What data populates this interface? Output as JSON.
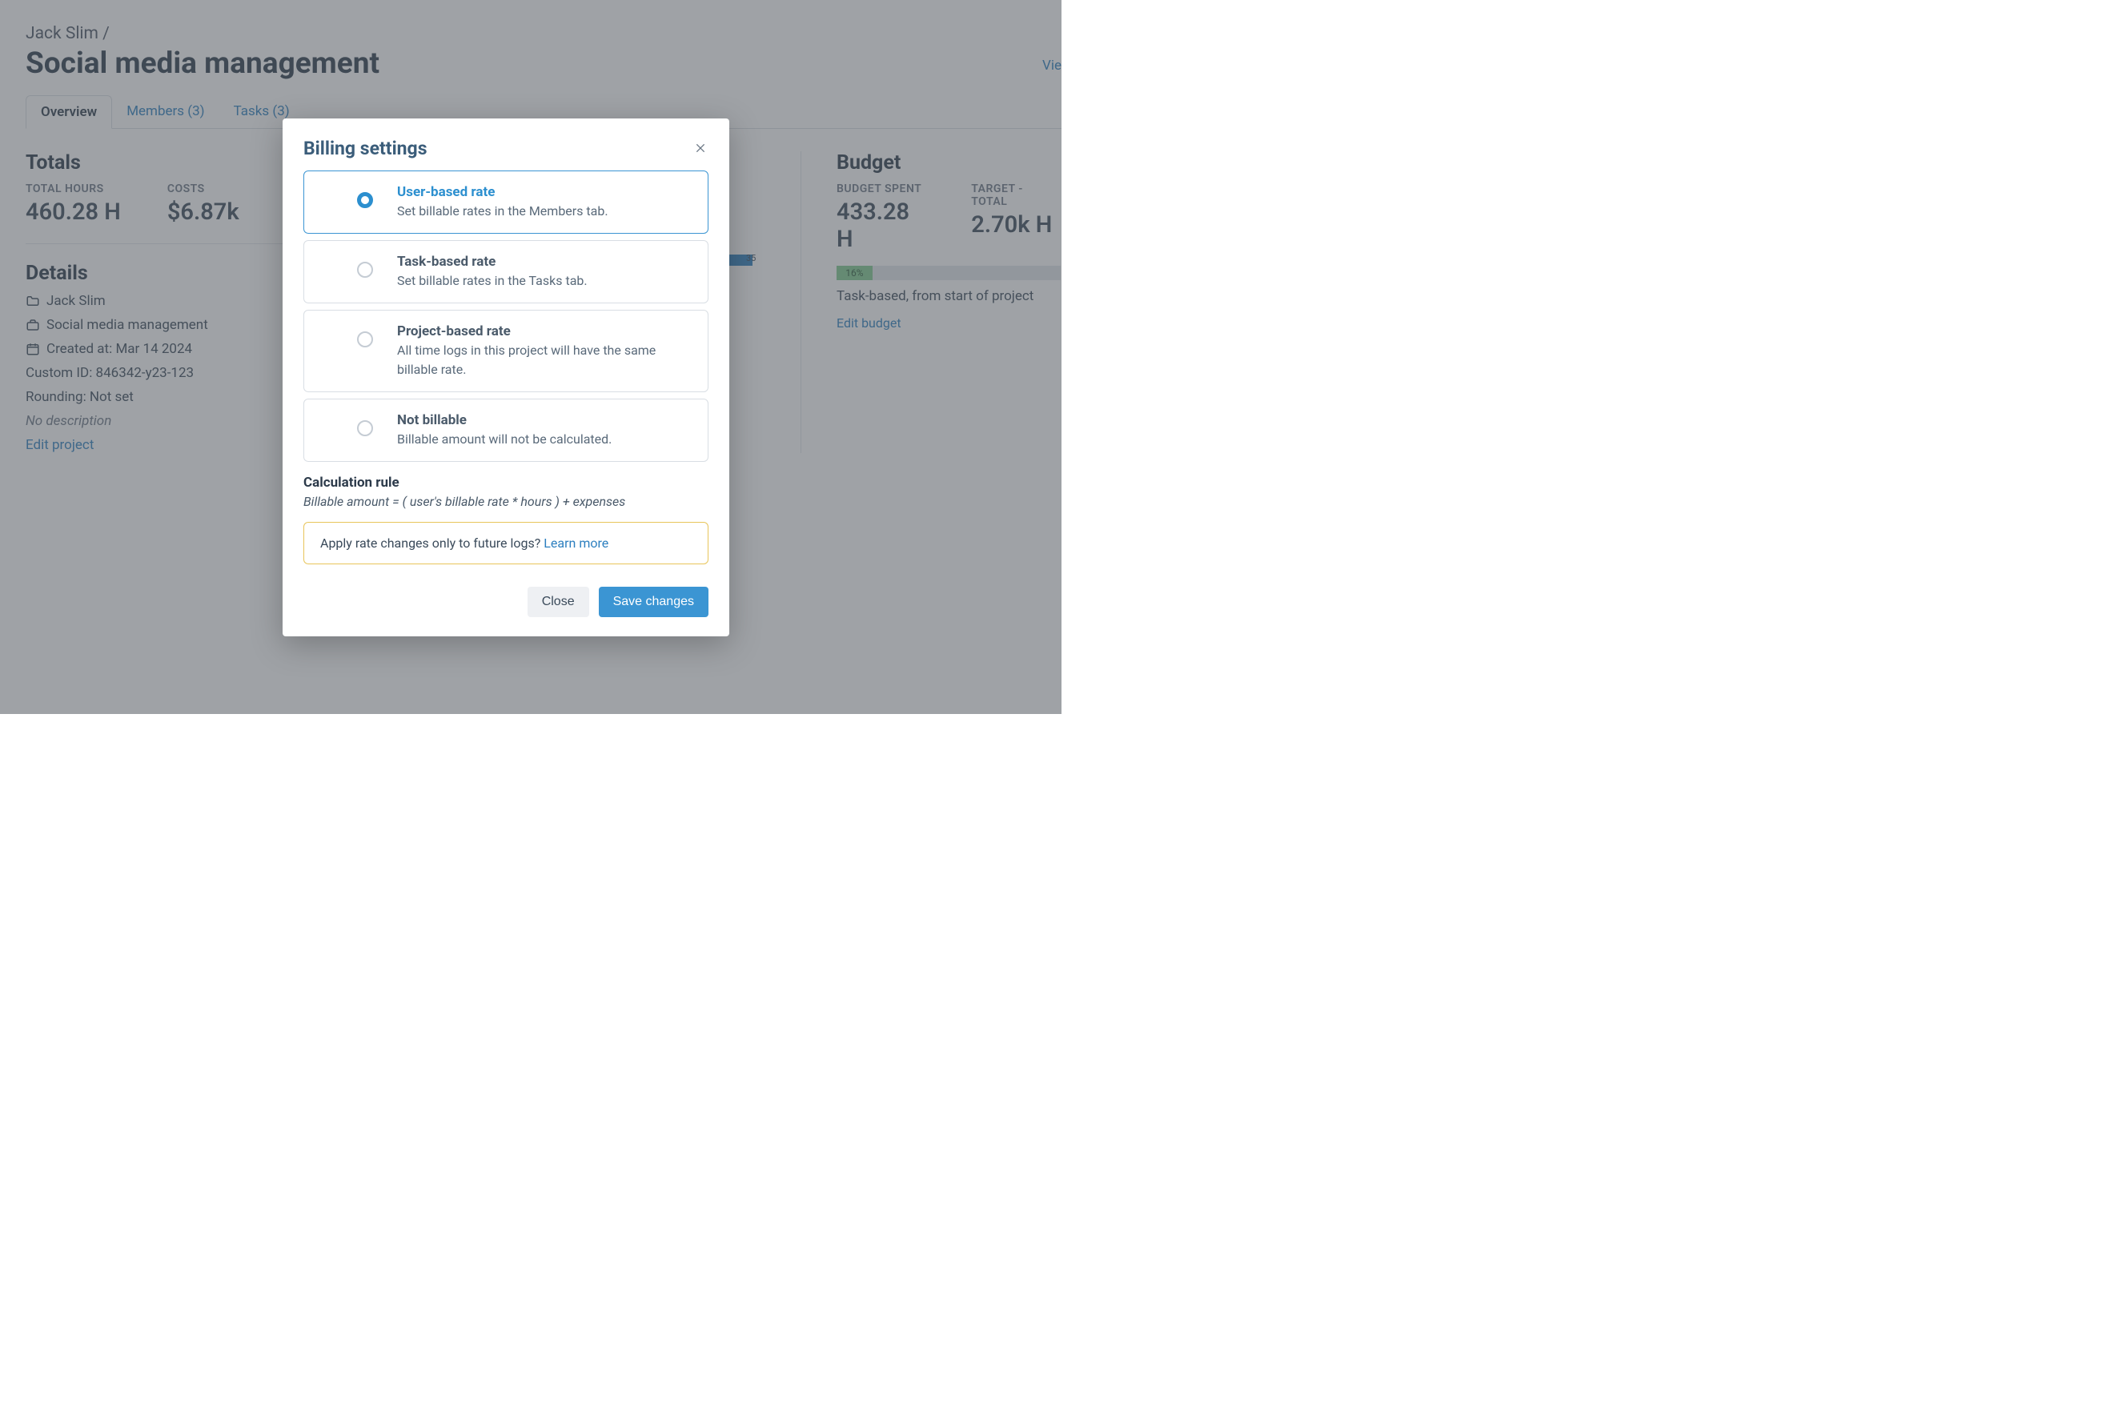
{
  "breadcrumb": {
    "owner": "Jack Slim",
    "sep": "/"
  },
  "page_title": "Social media management",
  "view_cut": "Vie",
  "tabs": [
    {
      "label": "Overview",
      "active": true
    },
    {
      "label": "Members (3)",
      "active": false
    },
    {
      "label": "Tasks (3)",
      "active": false
    }
  ],
  "totals": {
    "heading": "Totals",
    "hours_label": "TOTAL HOURS",
    "hours_value": "460.28 H",
    "costs_label": "COSTS",
    "costs_value": "$6.87k"
  },
  "details": {
    "heading": "Details",
    "client": "Jack Slim",
    "project": "Social media management",
    "created": "Created at: Mar 14 2024",
    "custom_id": "Custom ID: 846342-y23-123",
    "rounding": "Rounding: Not set",
    "no_description": "No description",
    "edit_link": "Edit project"
  },
  "mini_bar_label": "35",
  "budget": {
    "heading": "Budget",
    "spent_label": "BUDGET SPENT",
    "spent_value": "433.28 H",
    "target_label": "TARGET - TOTAL",
    "target_value": "2.70k H",
    "progress_pct": "16%",
    "type_text": "Task-based, from start of project",
    "edit_link": "Edit budget"
  },
  "modal": {
    "title": "Billing settings",
    "options": [
      {
        "title": "User-based rate",
        "desc": "Set billable rates in the Members tab.",
        "selected": true
      },
      {
        "title": "Task-based rate",
        "desc": "Set billable rates in the Tasks tab.",
        "selected": false
      },
      {
        "title": "Project-based rate",
        "desc": "All time logs in this project will have the same billable rate.",
        "selected": false
      },
      {
        "title": "Not billable",
        "desc": "Billable amount will not be calculated.",
        "selected": false
      }
    ],
    "calc_heading": "Calculation rule",
    "calc_formula": "Billable amount = ( user's billable rate * hours ) + expenses",
    "info_text": "Apply rate changes only to future logs? ",
    "info_link": "Learn more",
    "close_btn": "Close",
    "save_btn": "Save changes"
  }
}
